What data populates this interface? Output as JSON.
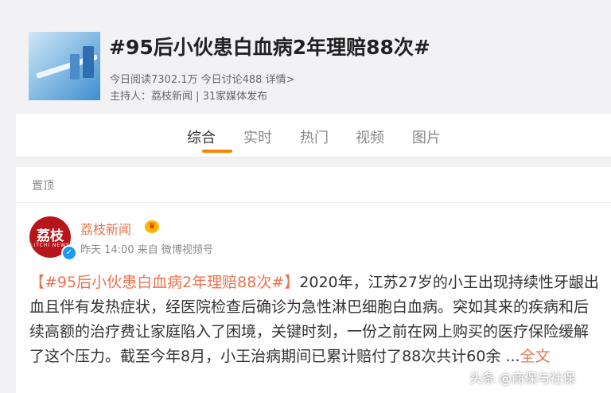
{
  "topic": {
    "title": "#95后小伙患白血病2年理赔88次#",
    "stats": "今日阅读7302.1万 今日讨论488 详情>",
    "host": "主持人：荔枝新闻 | 31家媒体发布"
  },
  "tabs": [
    {
      "label": "综合",
      "active": true
    },
    {
      "label": "实时"
    },
    {
      "label": "热门"
    },
    {
      "label": "视频"
    },
    {
      "label": "图片"
    }
  ],
  "section": {
    "pinned": "置顶"
  },
  "post": {
    "author": "荔枝新闻",
    "avatar_text": "荔枝",
    "avatar_subtext": "LITCHI NEWS",
    "meta": "昨天 14:00 来自 微博视频号",
    "tag_text": "【#95后小伙患白血病2年理赔88次#】",
    "body": "2020年，江苏27岁的小王出现持续性牙龈出血且伴有发热症状，经医院检查后确诊为急性淋巴细胞白血病。突如其来的疾病和后续高额的治疗费让家庭陷入了困境，关键时刻，一份之前在网上购买的医疗保险缓解了这个压力。截至今年8月，小王治病期间已累计赔付了88次共计60余 ...",
    "more": "全文"
  },
  "watermark": "头条 @商保与社保",
  "colors": {
    "accent": "#ff8200",
    "link": "#eb7350",
    "verified": "#1a9bf0"
  }
}
